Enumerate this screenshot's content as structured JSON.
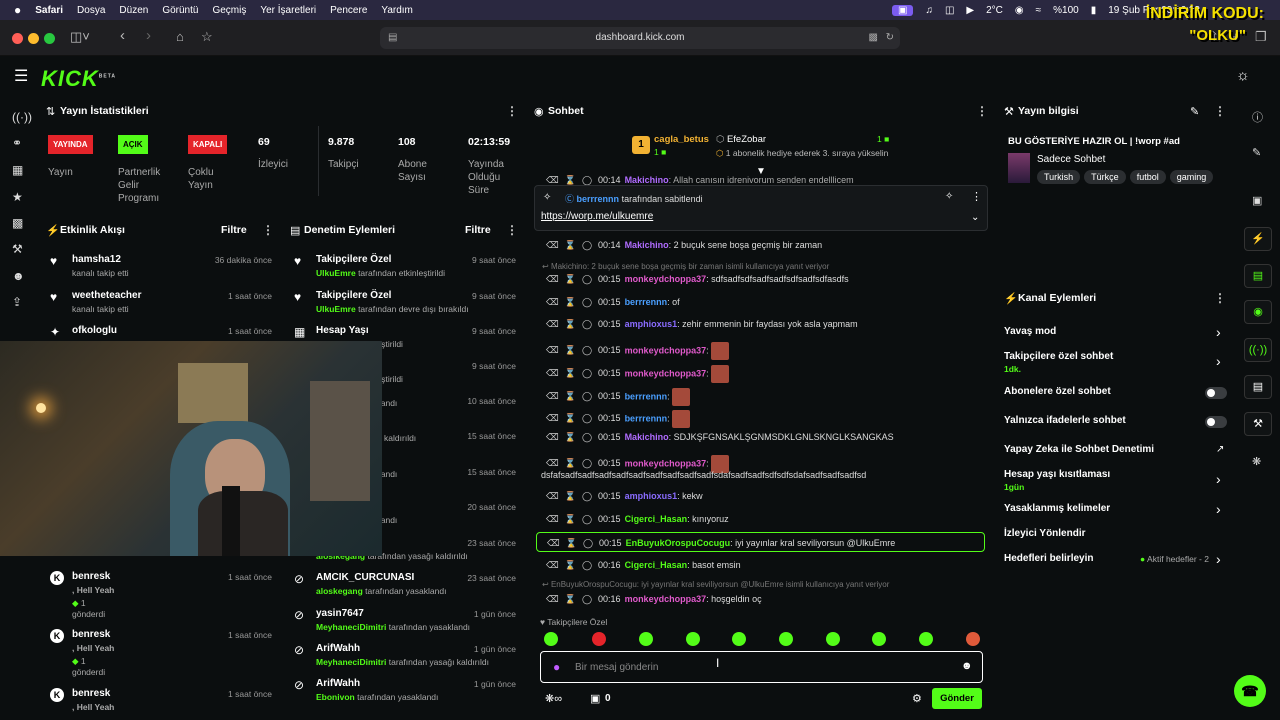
{
  "menubar": {
    "apple": "",
    "items": [
      "Safari",
      "Dosya",
      "Düzen",
      "Görüntü",
      "Geçmiş",
      "Yer İşaretleri",
      "Pencere",
      "Yardım"
    ],
    "temp": "2°C",
    "battery": "%100",
    "datetime": "19 Şub Per  00:16:32"
  },
  "overlay": {
    "promo_line1": "İNDİRİM KODU:",
    "promo_line2": "\"OLKU\""
  },
  "browser": {
    "url": "dashboard.kick.com"
  },
  "app": {
    "logo": "KICK",
    "logo_beta": "BETA"
  },
  "stream_stats": {
    "title": "Yayın İstatistikleri",
    "status_badges": [
      {
        "badge": "YAYINDA",
        "label": "Yayın",
        "color": "#e5242a"
      },
      {
        "badge": "AÇIK",
        "label": "Partnerlik Gelir Programı",
        "color": "#53fc18"
      },
      {
        "badge": "KAPALI",
        "label": "Çoklu Yayın",
        "color": "#e5242a"
      }
    ],
    "viewers": {
      "value": "69",
      "label": "İzleyici"
    },
    "followers": {
      "value": "9.878",
      "label": "Takipçi"
    },
    "subs": {
      "value": "108",
      "label": "Abone Sayısı"
    },
    "duration": {
      "value": "02:13:59",
      "label": "Yayında Olduğu Süre"
    }
  },
  "activity": {
    "title": "Etkinlik Akışı",
    "filter": "Filtre",
    "items": [
      {
        "name": "hamsha12",
        "sub": "kanalı takip etti",
        "time": "36 dakika önce"
      },
      {
        "name": "weetheteacher",
        "sub": "kanalı takip etti",
        "time": "1 saat önce"
      },
      {
        "name": "ofkologlu",
        "sub": "",
        "time": "1 saat önce"
      },
      {
        "name": "benresk",
        "sub": ", Hell Yeah",
        "extra": "1",
        "sub2": "gönderdi",
        "time": "1 saat önce"
      },
      {
        "name": "benresk",
        "sub": ", Hell Yeah",
        "extra": "1",
        "sub2": "gönderdi",
        "time": "1 saat önce"
      },
      {
        "name": "benresk",
        "sub": ", Hell Yeah",
        "time": "1 saat önce"
      }
    ]
  },
  "moderation": {
    "title": "Denetim Eylemleri",
    "filter": "Filtre",
    "items": [
      {
        "name": "Takipçilere Özel",
        "user": "UlkuEmre",
        "sub": "tarafından etkinleştirildi",
        "time": "9 saat önce"
      },
      {
        "name": "Takipçilere Özel",
        "user": "UlkuEmre",
        "sub": "tarafından devre dışı bırakıldı",
        "time": "9 saat önce"
      },
      {
        "name": "Hesap Yaşı",
        "user": "",
        "sub": "tarafından etkinleştirildi",
        "time": "9 saat önce"
      },
      {
        "name": "el",
        "user": "",
        "sub": "tarafından etkinleştirildi",
        "time": "9 saat önce"
      },
      {
        "name": "",
        "user": "",
        "sub": "tarafından yasaklandı",
        "time": "10 saat önce"
      },
      {
        "name": "",
        "user": "",
        "sub": "tarafından yasağı kaldırıldı",
        "time": "15 saat önce"
      },
      {
        "name": "",
        "user": "",
        "sub": "tarafından yasaklandı",
        "time": "15 saat önce"
      },
      {
        "name": "omiste",
        "user": "",
        "sub": "tarafından yasaklandı",
        "time": "20 saat önce"
      },
      {
        "name": "CUNASI",
        "user": "alosikegang",
        "sub": "tarafından yasağı kaldırıldı",
        "time": "23 saat önce"
      },
      {
        "name": "AMCIK_CURCUNASI",
        "user": "aloskegang",
        "sub": "tarafından yasaklandı",
        "time": "23 saat önce"
      },
      {
        "name": "yasin7647",
        "user": "MeyhaneciDimitri",
        "sub": "tarafından yasaklandı",
        "time": "1 gün önce"
      },
      {
        "name": "ArifWahh",
        "user": "MeyhaneciDimitri",
        "sub": "tarafından yasağı kaldırıldı",
        "time": "1 gün önce"
      },
      {
        "name": "ArifWahh",
        "user": "Ebonivon",
        "sub": "tarafından yasaklandı",
        "time": "1 gün önce"
      }
    ]
  },
  "chat": {
    "title": "Sohbet",
    "top_gifter": {
      "name": "cagla_betus",
      "rank": "1",
      "count": "1"
    },
    "top_sub": {
      "name": "EfeZobar",
      "count": "1",
      "note": "1 abonelik hediye ederek 3. sıraya yükselin"
    },
    "pinned": {
      "by": "berrrennn",
      "by_text": "tarafından sabitlendi",
      "link": "https://worp.me/ulkuemre"
    },
    "cut_line": {
      "user": "Makichino",
      "text": ": Allah canısın idrenivorum senden endelllicem"
    },
    "messages": [
      {
        "time": "00:14",
        "user": "Makichino",
        "color": "#b06cff",
        "text": ": 2 buçuk sene boşa geçmiş bir zaman"
      },
      {
        "reply": "Makichino: 2 buçuk sene boşa geçmiş bir zaman isimli kullanıcıya yanıt veriyor"
      },
      {
        "time": "00:15",
        "user": "monkeydchoppa37",
        "color": "#e05acb",
        "text": ": sdfsadfsdfsadfsadfsdfsadfsdfasdfs"
      },
      {
        "time": "00:15",
        "user": "berrrennn",
        "color": "#4a9fff",
        "text": ": of"
      },
      {
        "time": "00:15",
        "user": "amphioxus1",
        "color": "#8a6cff",
        "text": ": zehir emmenin bir faydası yok asla yapmam"
      },
      {
        "time": "00:15",
        "user": "monkeydchoppa37",
        "color": "#e05acb",
        "text": ":"
      },
      {
        "time": "00:15",
        "user": "monkeydchoppa37",
        "color": "#e05acb",
        "text": ":"
      },
      {
        "time": "00:15",
        "user": "berrrennn",
        "color": "#4a9fff",
        "text": ":"
      },
      {
        "time": "00:15",
        "user": "berrrennn",
        "color": "#4a9fff",
        "text": ":"
      },
      {
        "time": "00:15",
        "user": "Makichino",
        "color": "#b06cff",
        "text": ": SDJKŞFGNSAKLŞGNMSDKLGNLSKNGLKSANGKAS"
      },
      {
        "time": "00:15",
        "user": "monkeydchoppa37",
        "color": "#e05acb",
        "text": ":"
      },
      {
        "wrap": "dsfafsadfsadfsadfsadfsadfsadfsadfsadfsadfsdafsadfsadfsdfsdfsdafsadfsadfsadfsd"
      },
      {
        "time": "00:15",
        "user": "amphioxus1",
        "color": "#8a6cff",
        "text": ": kekw"
      },
      {
        "time": "00:15",
        "user": "Cigerci_Hasan",
        "color": "#53fc18",
        "text": ": kınıyoruz"
      },
      {
        "time": "00:15",
        "user": "EnBuyukOrospuCocugu",
        "color": "#53fc18",
        "text": ": iyi yayınlar kral seviliyorsun @UlkuEmre"
      },
      {
        "time": "00:16",
        "user": "Cigerci_Hasan",
        "color": "#53fc18",
        "text": ": basot emsin"
      },
      {
        "reply": "EnBuyukOrospuCocugu: iyi yayınlar kral seviliyorsun @UlkuEmre isimli kullanıcıya yanıt veriyor"
      },
      {
        "time": "00:16",
        "user": "monkeydchoppa37",
        "color": "#e05acb",
        "text": ": hoşgeldin oç"
      }
    ],
    "mode_label": "Takipçilere Özel",
    "input_placeholder": "Bir mesaj gönderin",
    "points": "0",
    "send": "Gönder"
  },
  "stream_info": {
    "title": "Yayın bilgisi",
    "stream_title": "BU GÖSTERİYE HAZIR OL | !worp #ad",
    "category": "Sadece Sohbet",
    "tags": [
      "Turkish",
      "Türkçe",
      "futbol",
      "gaming"
    ]
  },
  "channel_actions": {
    "title": "Kanal Eylemleri",
    "items": [
      {
        "label": "Yavaş mod",
        "sub": "",
        "control": "chevron"
      },
      {
        "label": "Takipçilere özel sohbet",
        "sub": "1dk.",
        "control": "chevron"
      },
      {
        "label": "Abonelere özel sohbet",
        "sub": "",
        "control": "toggle"
      },
      {
        "label": "Yalnızca ifadelerle sohbet",
        "sub": "",
        "control": "toggle"
      },
      {
        "label": "Yapay Zeka ile Sohbet Denetimi",
        "sub": "",
        "control": "external"
      },
      {
        "label": "Hesap yaşı kısıtlaması",
        "sub": "1gün",
        "control": "chevron"
      },
      {
        "label": "Yasaklanmış kelimeler",
        "sub": "",
        "control": "chevron"
      },
      {
        "label": "İzleyici Yönlendir",
        "sub": "",
        "control": "none"
      },
      {
        "label": "Hedefleri belirleyin",
        "sub": "",
        "control": "chevron",
        "note": "Aktif hedefler - 2"
      }
    ]
  },
  "colors": {
    "accent": "#53fc18",
    "live": "#e5242a",
    "bg": "#0b0e0f"
  }
}
